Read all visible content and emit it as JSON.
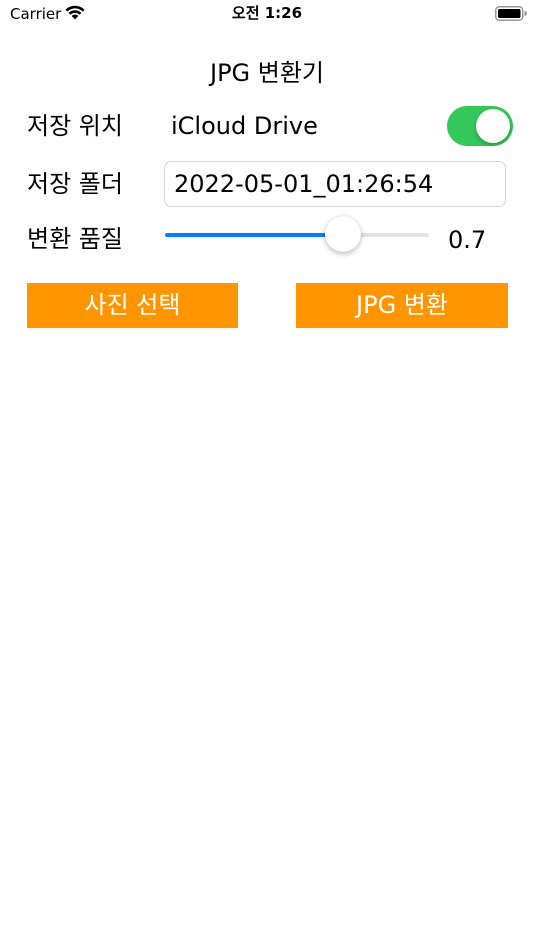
{
  "status_bar": {
    "carrier": "Carrier",
    "time": "오전 1:26",
    "wifi_icon": "wifi-icon",
    "battery_icon": "battery-icon"
  },
  "screen": {
    "title": "JPG 변환기"
  },
  "location": {
    "label": "저장 위치",
    "value": "iCloud Drive",
    "toggle_on": true,
    "toggle_color": "#34c759"
  },
  "folder": {
    "label": "저장 폴더",
    "value": "2022-05-01_01:26:54"
  },
  "quality": {
    "label": "변환 품질",
    "value_text": "0.7",
    "value": 0.7,
    "accent_color": "#0a7cff"
  },
  "buttons": {
    "select_photo": "사진 선택",
    "convert_jpg": "JPG 변환",
    "color": "#ff9500"
  }
}
